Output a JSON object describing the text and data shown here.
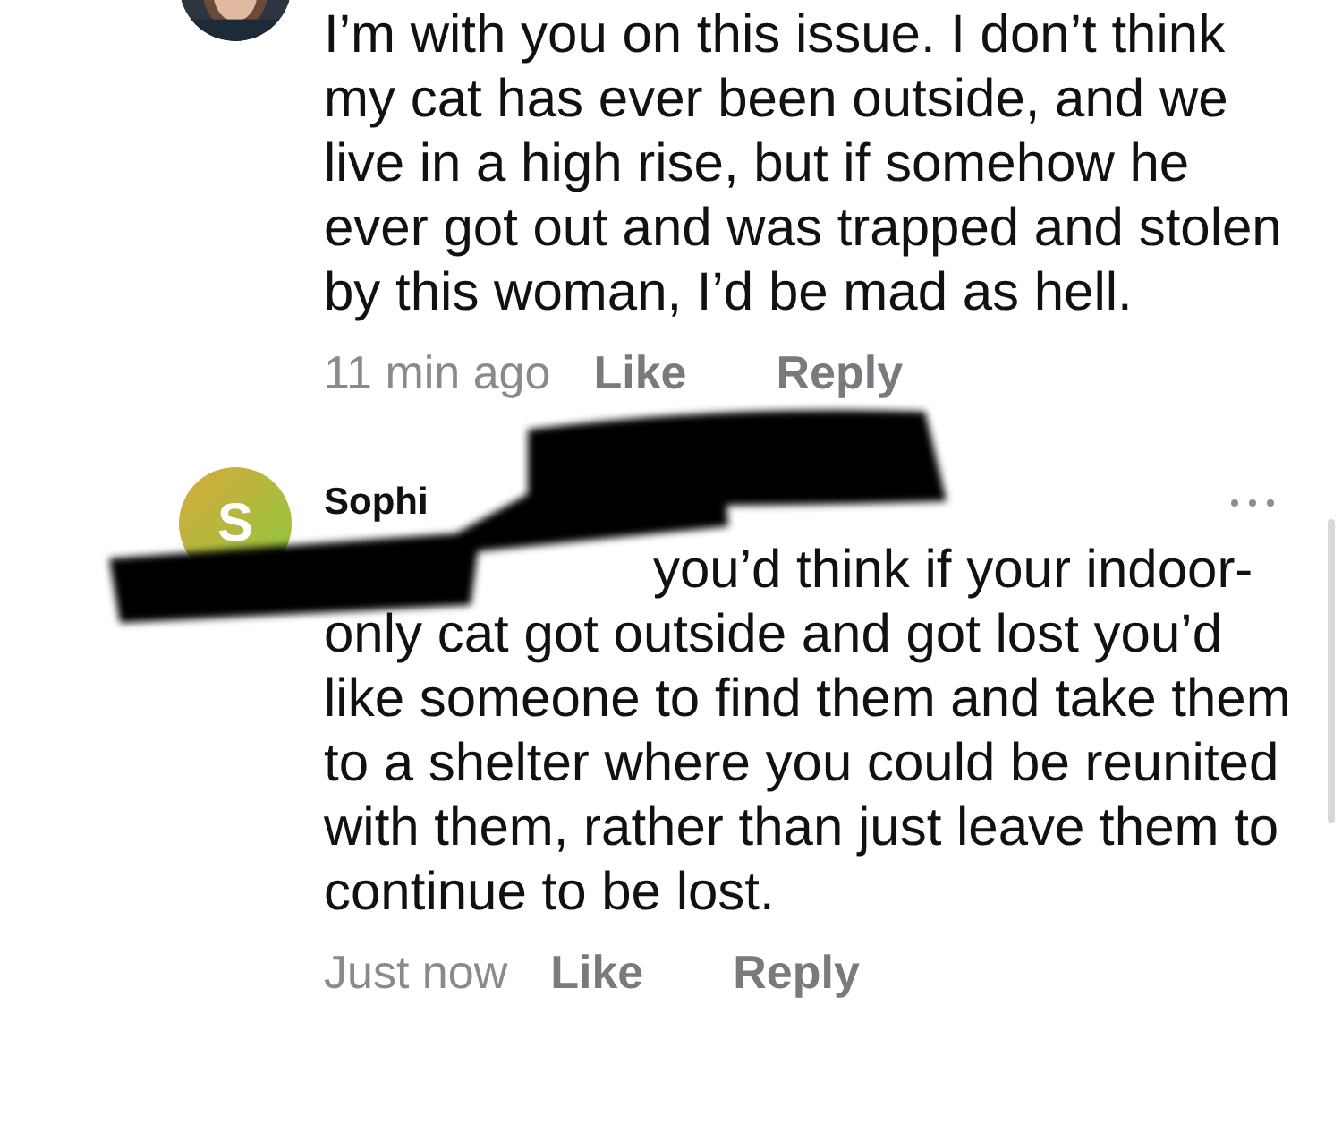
{
  "comments": [
    {
      "text": "I’m with you on this issue. I don’t think my cat has ever been outside, and we live in a high rise, but if somehow he ever got out and was trapped and stolen by this woman, I’d be mad as hell.",
      "time": "11 min ago",
      "actions": [
        "Like",
        "Reply"
      ]
    },
    {
      "avatar": {
        "kind": "initial",
        "letter": "S"
      },
      "author": "Sophi",
      "text": "you’d think if your indoor-only cat got outside and got lost you’d like someone to find them and take them to a shelter where you could be reunited with them, rather than just leave them to continue to be lost.",
      "time": "Just now",
      "actions": [
        "Like",
        "Reply"
      ],
      "menu": true,
      "redacted": true
    }
  ]
}
